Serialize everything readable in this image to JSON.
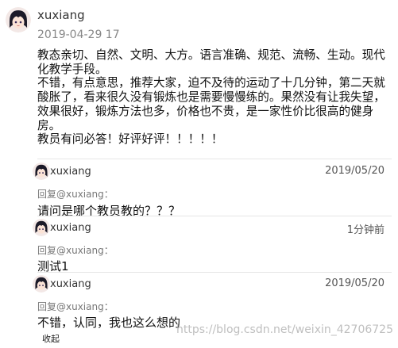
{
  "review": {
    "username": "xuxiang",
    "date": "2019-04-29 17",
    "paragraphs": [
      "教态亲切、自然、文明、大方。语言准确、规范、流畅、生动。现代化教学手段。",
      "不错，有点意思，推荐大家，迫不及待的运动了十几分钟，第二天就酸胀了，看来很久没有锻炼也是需要慢慢练的。果然没有让我失望，效果很好，锻炼方法也多，价格也不贵，是一家性价比很高的健身房。",
      "教员有问必答！好评好评！！！！！"
    ]
  },
  "replies": [
    {
      "username": "xuxiang",
      "time": "2019/05/20",
      "reply_to": "回复@xuxiang：",
      "text": "请问是哪个教员教的？？？"
    },
    {
      "username": "xuxiang",
      "time": "1分钟前",
      "reply_to": "回复@xuxiang：",
      "text": "测试1"
    },
    {
      "username": "xuxiang",
      "time": "2019/05/20",
      "reply_to": "回复@xuxiang：",
      "text": "不错，认同，我也这么想的"
    }
  ],
  "collapse_label": "收起",
  "watermark": "https://blog.csdn.net/weixin_42706725",
  "colors": {
    "text": "#111111",
    "meta": "#888888",
    "watermark": "#aaaaaa"
  }
}
